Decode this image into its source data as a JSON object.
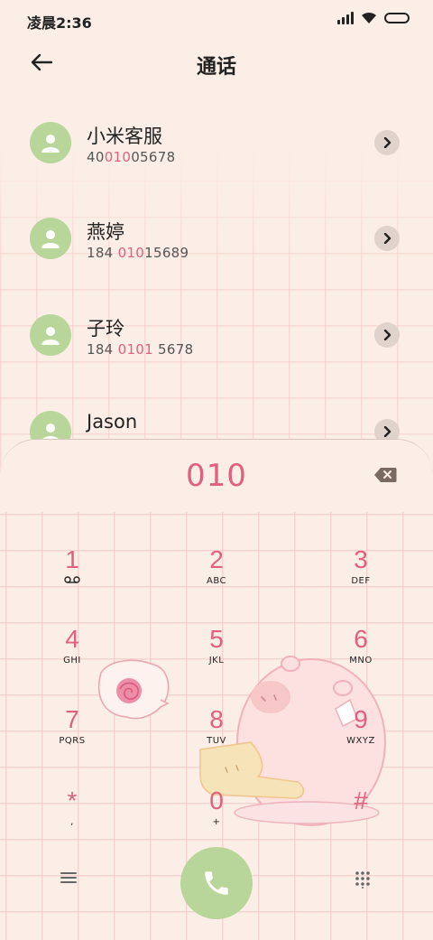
{
  "status": {
    "time": "凌晨2:36"
  },
  "header": {
    "title": "通话"
  },
  "contacts": [
    {
      "name": "小米客服",
      "num_pre": "40",
      "num_hl": "010",
      "num_post": "05678"
    },
    {
      "name": "燕婷",
      "num_pre": "184 ",
      "num_hl": "010",
      "num_post": "15689"
    },
    {
      "name": "子玲",
      "num_pre": "184 ",
      "num_hl": "0101",
      "num_post": " 5678"
    },
    {
      "name": "Jason",
      "num_pre": "",
      "num_hl": "",
      "num_post": ""
    }
  ],
  "dialer": {
    "input": "010",
    "keys": [
      {
        "digit": "1",
        "letters": ""
      },
      {
        "digit": "2",
        "letters": "ABC"
      },
      {
        "digit": "3",
        "letters": "DEF"
      },
      {
        "digit": "4",
        "letters": "GHI"
      },
      {
        "digit": "5",
        "letters": "JKL"
      },
      {
        "digit": "6",
        "letters": "MNO"
      },
      {
        "digit": "7",
        "letters": "PQRS"
      },
      {
        "digit": "8",
        "letters": "TUV"
      },
      {
        "digit": "9",
        "letters": "WXYZ"
      },
      {
        "digit": "*",
        "letters": ","
      },
      {
        "digit": "0",
        "letters": "+"
      },
      {
        "digit": "#",
        "letters": ""
      }
    ]
  },
  "icons": {
    "back": "arrow-left-icon",
    "contact": "person-icon",
    "detail": "chevron-right-icon",
    "backspace": "backspace-icon",
    "voicemail": "voicemail-icon",
    "menu": "menu-icon",
    "call": "phone-icon",
    "keypad": "dialpad-icon"
  },
  "colors": {
    "accent": "#e0607e",
    "avatar": "#b8d69a",
    "background": "#fbeee6"
  }
}
